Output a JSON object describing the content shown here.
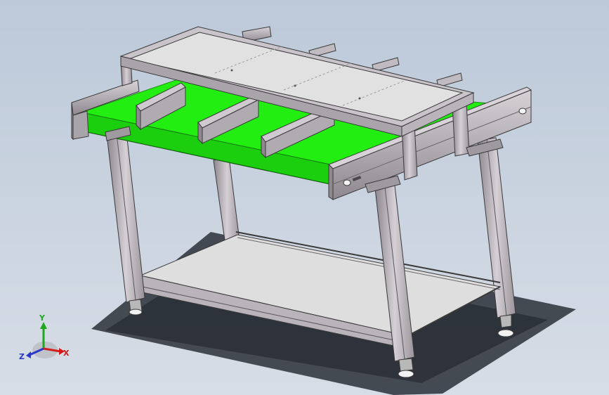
{
  "viewport": {
    "background_top": "#bcc9d9",
    "background_bottom": "#d7dde6"
  },
  "model": {
    "belt_color": "#22ee11",
    "frame_color": "#c9c4c9",
    "frame_edge_color": "#3a3a3a",
    "panel_color": "#dcdcdc",
    "shadow_color": "#2a3038"
  },
  "triad": {
    "x_label": "X",
    "y_label": "Y",
    "z_label": "Z",
    "x_color": "#d21c1c",
    "y_color": "#1fa81f",
    "z_color": "#2b39c8"
  }
}
